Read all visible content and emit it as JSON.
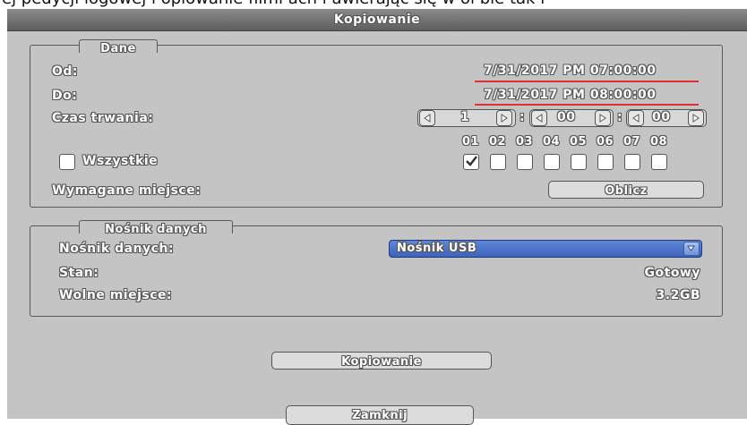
{
  "window": {
    "title": "Kopiowanie",
    "top_fragment": "ej pedycji logowej i opiowanie filmi ach i awierając się w oi bie tak i"
  },
  "data_group": {
    "title": "Dane",
    "from_label": "Od:",
    "from_value": "7/31/2017 PM 07:00:00",
    "to_label": "Do:",
    "to_value": "7/31/2017 PM 08:00:00",
    "duration_label": "Czas trwania:",
    "duration": {
      "hours": "1",
      "minutes": "00",
      "seconds": "00",
      "sep": ":"
    },
    "channel_numbers": [
      "01",
      "02",
      "03",
      "04",
      "05",
      "06",
      "07",
      "08"
    ],
    "channel_checked": [
      true,
      false,
      false,
      false,
      false,
      false,
      false,
      false
    ],
    "all_label": "Wszystkie",
    "all_checked": false,
    "required_space_label": "Wymagane miejsce:",
    "calculate_button": "Oblicz"
  },
  "media_group": {
    "title": "Nośnik danych",
    "media_label": "Nośnik danych:",
    "media_value": "Nośnik USB",
    "status_label": "Stan:",
    "status_value": "Gotowy",
    "free_label": "Wolne miejsce:",
    "free_value": "3.2GB"
  },
  "buttons": {
    "copy": "Kopiowanie",
    "close": "Zamknij"
  },
  "colors": {
    "panel": "#c4c4c4",
    "titlebar": "#6e6e6e",
    "select": "#4a70c8",
    "underline": "#e03030"
  }
}
